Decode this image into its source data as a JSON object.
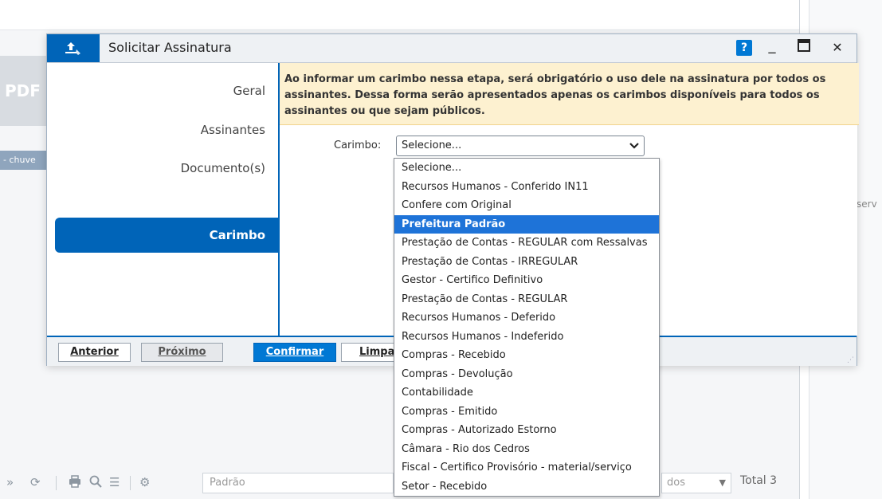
{
  "background": {
    "pdf_thumb_label": "PDF",
    "tag_chip_label": "- chuve",
    "right_partial_text": "serv",
    "bottom_toolbar": {
      "search_placeholder": "Padrão",
      "pager_value": "dos",
      "total_label": "Total 3"
    }
  },
  "dialog": {
    "title": "Solicitar Assinatura",
    "help_label": "?",
    "minimize_label": "_",
    "close_label": "✕",
    "sidebar": {
      "items": [
        "Geral",
        "Assinantes",
        "Documento(s)"
      ],
      "active_item": "Carimbo"
    },
    "notice": "Ao informar um carimbo nessa etapa, será obrigatório o uso dele na assinatura por todos os assinantes. Dessa forma serão apresentados apenas os carimbos disponíveis para todos os assinantes ou que sejam públicos.",
    "carimbo_label": "Carimbo:",
    "carimbo_selected": "Selecione...",
    "footer": {
      "anterior": "Anterior",
      "proximo": "Próximo",
      "confirmar": "Confirmar",
      "limpar_partial": "Limpa"
    }
  },
  "dropdown": {
    "highlighted_index": 3,
    "options": [
      "Selecione...",
      "Recursos Humanos - Conferido IN11",
      "Confere com Original",
      "Prefeitura Padrão",
      "Prestação de Contas - REGULAR com Ressalvas",
      "Prestação de Contas - IRREGULAR",
      "Gestor - Certifico Definitivo",
      "Prestação de Contas - REGULAR",
      "Recursos Humanos - Deferido",
      "Recursos Humanos - Indeferido",
      "Compras - Recebido",
      "Compras - Devolução",
      "Contabilidade",
      "Compras - Emitido",
      "Compras - Autorizado Estorno",
      "Câmara - Rio dos Cedros",
      "Fiscal - Certifico Provisório - material/serviço",
      "Setor - Recebido"
    ]
  },
  "colors": {
    "brand_blue": "#0064b8",
    "selected_blue": "#1e73d8",
    "notice_bg": "#fdf1d0"
  }
}
